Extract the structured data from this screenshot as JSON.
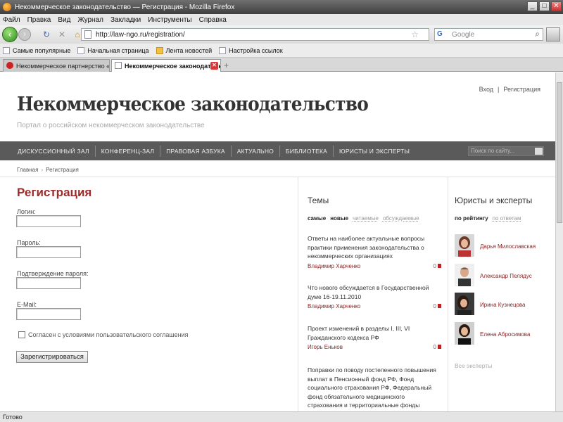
{
  "window": {
    "title": "Некоммерческое законодательство — Регистрация - Mozilla Firefox"
  },
  "menu": [
    "Файл",
    "Правка",
    "Вид",
    "Журнал",
    "Закладки",
    "Инструменты",
    "Справка"
  ],
  "nav": {
    "url": "http://law-ngo.ru/registration/",
    "search_placeholder": "Google"
  },
  "bookmarks": [
    "Самые популярные",
    "Начальная страница",
    "Лента новостей",
    "Настройка ссылок"
  ],
  "tabs": [
    "Некоммерческое партнерство «Юрис...",
    "Некоммерческое законодатель..."
  ],
  "site": {
    "login_link": "Вход",
    "register_link": "Регистрация",
    "title": "Некоммерческое законодательство",
    "subtitle": "Портал о российском некоммерческом законодательстве",
    "nav": [
      "ДИСКУССИОННЫЙ ЗАЛ",
      "КОНФЕРЕНЦ-ЗАЛ",
      "ПРАВОВАЯ АЗБУКА",
      "АКТУАЛЬНО",
      "БИБЛИОТЕКА",
      "ЮРИСТЫ И ЭКСПЕРТЫ"
    ],
    "search_placeholder": "Поиск по сайту..."
  },
  "breadcrumb": {
    "home": "Главная",
    "current": "Регистрация"
  },
  "form": {
    "title": "Регистрация",
    "login_label": "Логин:",
    "password_label": "Пароль:",
    "confirm_label": "Подтверждение пароля:",
    "email_label": "E-Mail:",
    "agree_label": "Согласен с условиями пользовательского соглашения",
    "submit": "Зарегистрироваться"
  },
  "topics": {
    "title": "Темы",
    "tabs": [
      "самые",
      "новые",
      "читаемые",
      "обсуждаемые"
    ],
    "items": [
      {
        "text": "Ответы на наиболее актуальные вопросы практики применения законодательства о некоммерческих организациях",
        "author": "Владимир Харченко",
        "count": "0"
      },
      {
        "text": "Что нового обсуждается в Государственной думе 16-19.11.2010",
        "author": "Владимир Харченко",
        "count": "0"
      },
      {
        "text": "Проект изменений в разделы I, III, VI Гражданского кодекса РФ",
        "author": "Игорь Еньков",
        "count": "0"
      },
      {
        "text": "Поправки по поводу постепенного повышения выплат в Пенсионный фонд РФ, Фонд социального страхования РФ, Федеральный фонд обязательного медицинского страхования и территориальные фонды обязательного медицинского страхования"
      }
    ]
  },
  "experts": {
    "title": "Юристы и эксперты",
    "tabs": [
      "по рейтингу",
      "по ответам"
    ],
    "items": [
      "Дарья Милославская",
      "Александр Пелядус",
      "Ирина Кузнецова",
      "Елена Абросимова"
    ],
    "all": "Все эксперты"
  },
  "status": "Готово"
}
